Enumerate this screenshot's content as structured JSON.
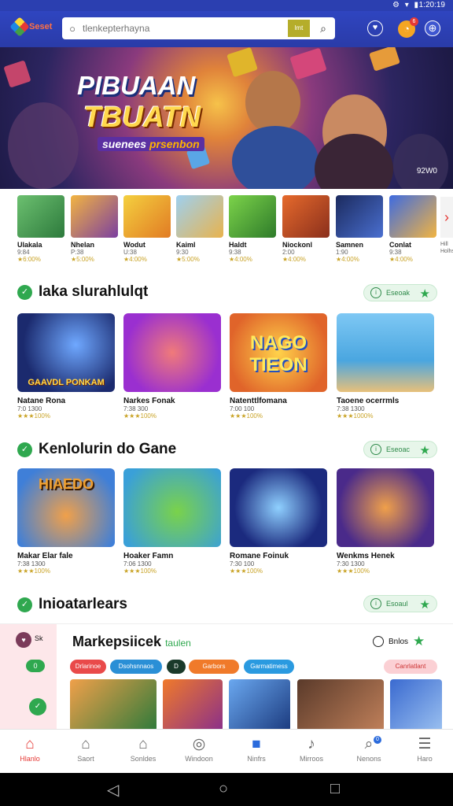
{
  "status_bar": {
    "time": "1:20:19",
    "icons": "⚙ ▾ ▮"
  },
  "header": {
    "logo_text": "Seset",
    "search_placeholder": "tlenkepterhayna",
    "search_chip": "lmt",
    "cart_badge": "6"
  },
  "banner": {
    "title_1": "PIBUAAN",
    "title_2": "TBUATN",
    "subtitle_a": "suenees",
    "subtitle_b": "prsenbon",
    "corner_label": "92W0"
  },
  "rail": {
    "items": [
      {
        "name": "Ulakala",
        "meta": "9:84",
        "stars": "★6:00%"
      },
      {
        "name": "Nhelan",
        "meta": "P:38",
        "stars": "★5:00%"
      },
      {
        "name": "Wodut",
        "meta": "U:38",
        "stars": "★4:00%"
      },
      {
        "name": "Kaiml",
        "meta": "9:30",
        "stars": "★5:00%"
      },
      {
        "name": "Haldt",
        "meta": "9:38",
        "stars": "★4:00%"
      },
      {
        "name": "Niockonl",
        "meta": "2:00",
        "stars": "★4:00%"
      },
      {
        "name": "Samnen",
        "meta": "1:90",
        "stars": "★4:00%"
      },
      {
        "name": "Conlat",
        "meta": "9:38",
        "stars": "★4:00%"
      }
    ],
    "more_label": "Hill Holhs"
  },
  "sections": [
    {
      "title": "Iaka slurahlulqt",
      "pill": "Eseoak",
      "cards": [
        {
          "name": "Natane Rona",
          "meta": "7:0 1300",
          "stars": "★★★100%",
          "art": "GAAVDL PONKAM"
        },
        {
          "name": "Narkes Fonak",
          "meta": "7:38 300",
          "stars": "★★★100%",
          "art": ""
        },
        {
          "name": "Natenttlfomana",
          "meta": "7:00 100",
          "stars": "★★★100%",
          "art": "NAGO TIEON"
        },
        {
          "name": "Taoene ocerrmls",
          "meta": "7:38 1300",
          "stars": "★★★1000%",
          "art": ""
        }
      ]
    },
    {
      "title": "Kenlolurin do Gane",
      "pill": "Eseoac",
      "cards": [
        {
          "name": "Makar Elar fale",
          "meta": "7:38 1300",
          "stars": "★★★100%",
          "art": "HIAEDO"
        },
        {
          "name": "Hoaker Famn",
          "meta": "7:06 1300",
          "stars": "★★★100%",
          "art": ""
        },
        {
          "name": "Romane Foinuk",
          "meta": "7:30 100",
          "stars": "★★★100%",
          "art": ""
        },
        {
          "name": "Wenkms Henek",
          "meta": "7:30 1300",
          "stars": "★★★100%",
          "art": ""
        }
      ]
    },
    {
      "title": "Inioatarlears",
      "pill": "Esoaul",
      "cards": []
    }
  ],
  "market": {
    "title": "Markepsiicek",
    "title_tag": "taulen",
    "right_label": "Bnlos",
    "tags": [
      "Drlarinoe",
      "Dsohsnnaos",
      "D",
      "Garbors",
      "Garmatimess"
    ],
    "right_tag": "Canrlatlant",
    "side_avatar": "Sk",
    "side_green": "0"
  },
  "nav": {
    "items": [
      {
        "label": "Hlanlo",
        "icon": "home-icon"
      },
      {
        "label": "Saort",
        "icon": "store-icon"
      },
      {
        "label": "Sonldes",
        "icon": "house-icon"
      },
      {
        "label": "Windoon",
        "icon": "wheel-icon"
      },
      {
        "label": "Ninfrs",
        "icon": "bookmark-icon"
      },
      {
        "label": "Mirroos",
        "icon": "music-icon"
      },
      {
        "label": "Nenons",
        "icon": "search-icon"
      },
      {
        "label": "Haro",
        "icon": "menu-icon"
      }
    ],
    "search_badge": "0"
  },
  "colors": {
    "primary": "#2b3fb0",
    "accent": "#e53935",
    "green": "#2fa84f",
    "gold": "#c9a326"
  }
}
